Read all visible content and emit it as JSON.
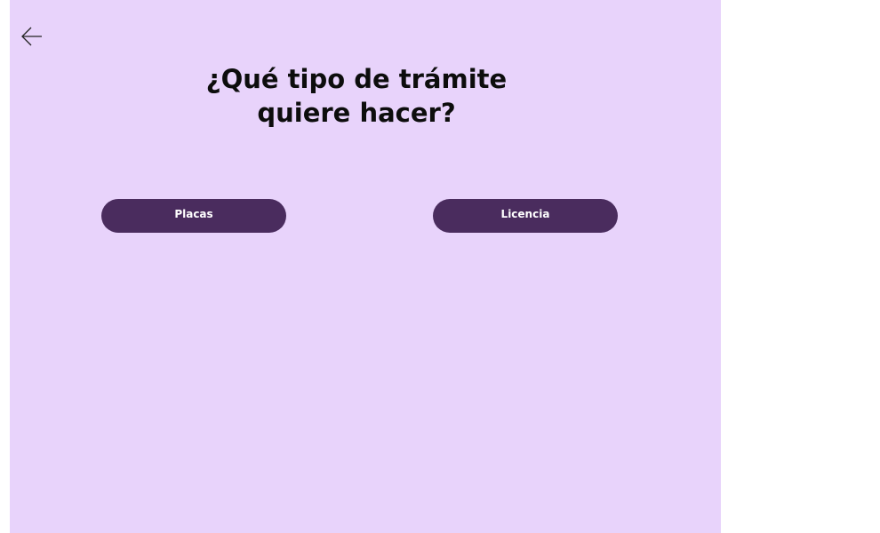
{
  "header": {
    "back_icon": "arrow-left-icon"
  },
  "main": {
    "title_line1": "¿Qué tipo de trámite",
    "title_line2": "quiere hacer?",
    "options": [
      {
        "label": "Placas"
      },
      {
        "label": "Licencia"
      }
    ]
  },
  "colors": {
    "background": "#e8d3fb",
    "button": "#4a2c5e",
    "button_text": "#ffffff",
    "title_text": "#0d0d0d"
  }
}
